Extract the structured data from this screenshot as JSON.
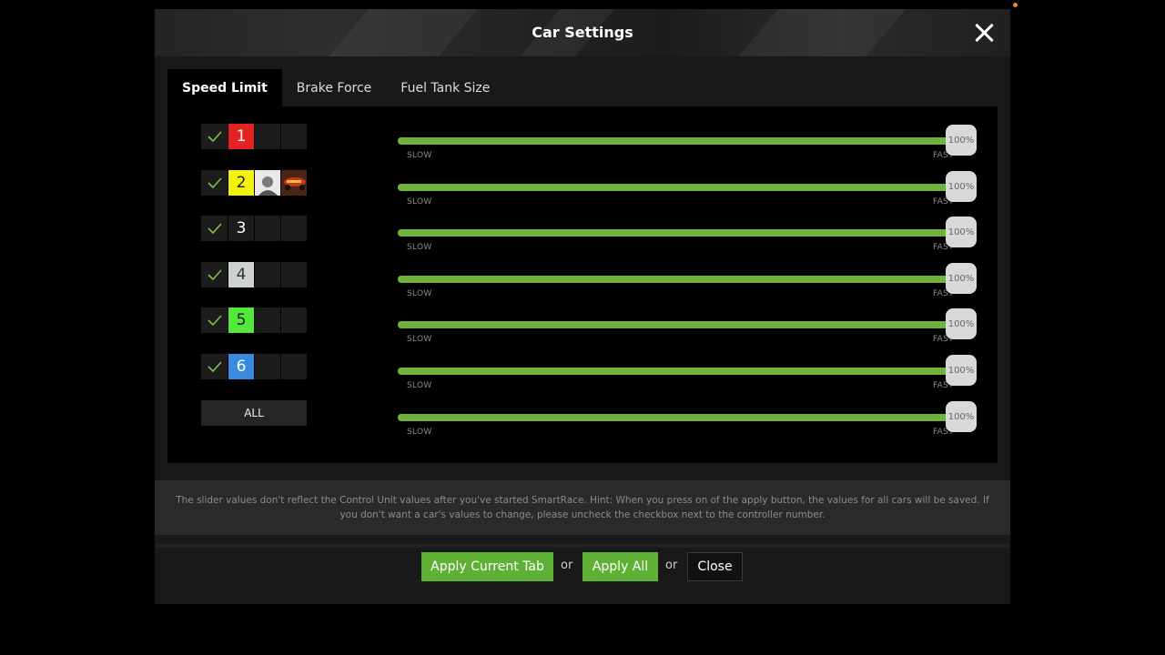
{
  "window": {
    "title": "Car Settings"
  },
  "tabs": [
    {
      "label": "Speed Limit",
      "active": true
    },
    {
      "label": "Brake Force",
      "active": false
    },
    {
      "label": "Fuel Tank Size",
      "active": false
    }
  ],
  "controllers": [
    {
      "number": "1",
      "checked": true,
      "color": "#e52222",
      "text_color": "#ffffff"
    },
    {
      "number": "2",
      "checked": true,
      "color": "#f2f20a",
      "text_color": "#222222",
      "has_driver_image": true,
      "has_car_image": true
    },
    {
      "number": "3",
      "checked": true,
      "color": "#1c1c1c",
      "text_color": "#ffffff"
    },
    {
      "number": "4",
      "checked": true,
      "color": "#cfd3cf",
      "text_color": "#333333"
    },
    {
      "number": "5",
      "checked": true,
      "color": "#53e83a",
      "text_color": "#1a1a1a"
    },
    {
      "number": "6",
      "checked": true,
      "color": "#3a8ae0",
      "text_color": "#ffffff"
    }
  ],
  "all_button": {
    "label": "ALL"
  },
  "sliders": [
    {
      "value": "100%",
      "fraction": 1.0,
      "min_label": "SLOW",
      "max_label": "FAST"
    },
    {
      "value": "100%",
      "fraction": 1.0,
      "min_label": "SLOW",
      "max_label": "FAST"
    },
    {
      "value": "100%",
      "fraction": 1.0,
      "min_label": "SLOW",
      "max_label": "FAST"
    },
    {
      "value": "100%",
      "fraction": 1.0,
      "min_label": "SLOW",
      "max_label": "FAST"
    },
    {
      "value": "100%",
      "fraction": 1.0,
      "min_label": "SLOW",
      "max_label": "FAST"
    },
    {
      "value": "100%",
      "fraction": 1.0,
      "min_label": "SLOW",
      "max_label": "FAST"
    },
    {
      "value": "100%",
      "fraction": 1.0,
      "min_label": "SLOW",
      "max_label": "FAST"
    }
  ],
  "hint": "The slider values don't reflect the Control Unit values after you've started SmartRace. Hint: When you press on of the apply button, the values for all cars will be saved. If you don't want a car's values to change, please uncheck the checkbox next to the controller number.",
  "footer": {
    "apply_current_label": "Apply Current Tab",
    "or_1": "or",
    "apply_all_label": "Apply All",
    "or_2": "or",
    "close_label": "Close"
  },
  "colors": {
    "accent_green": "#5fb136",
    "slider_green": "#6fb33a",
    "check_green": "#7ec04a"
  }
}
